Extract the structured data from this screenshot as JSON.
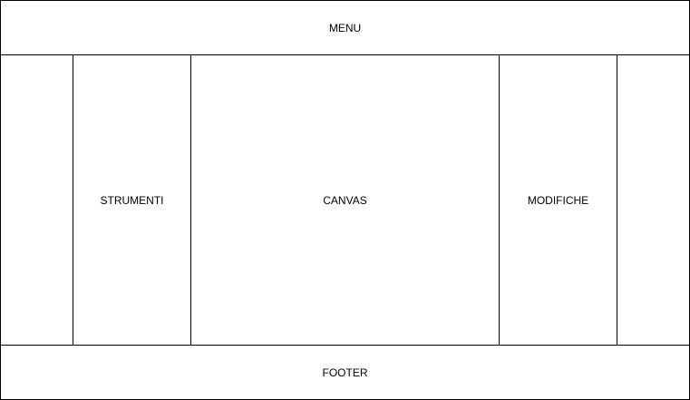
{
  "layout": {
    "menu": {
      "label": "MENU"
    },
    "left_margin": {
      "label": ""
    },
    "tools": {
      "label": "STRUMENTI"
    },
    "canvas": {
      "label": "CANVAS"
    },
    "edits": {
      "label": "MODIFICHE"
    },
    "right_margin": {
      "label": ""
    },
    "footer": {
      "label": "FOOTER"
    }
  },
  "colors": {
    "border": "#000000",
    "background": "#ffffff",
    "text": "#000000"
  }
}
